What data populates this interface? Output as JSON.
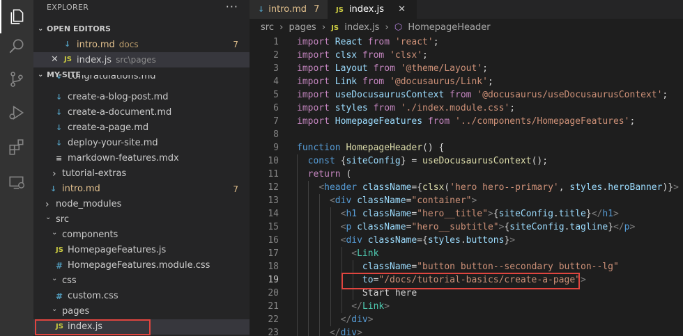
{
  "activity_bar": [
    {
      "name": "files-icon",
      "active": true
    },
    {
      "name": "search-icon"
    },
    {
      "name": "source-control-icon"
    },
    {
      "name": "run-debug-icon"
    },
    {
      "name": "extensions-icon"
    },
    {
      "name": "remote-explorer-icon"
    }
  ],
  "sidebar": {
    "title": "EXPLORER",
    "more": "···",
    "open_editors": {
      "header": "OPEN EDITORS",
      "items": [
        {
          "icon": "↓",
          "name": "intro.md",
          "dir": "docs",
          "badge": "7"
        },
        {
          "close": "✕",
          "icon": "JS",
          "name": "index.js",
          "dir": "src\\pages"
        }
      ]
    },
    "project": {
      "header": "MY-SITE",
      "tree": [
        {
          "icon": "↓",
          "name": "congratulations.md"
        },
        {
          "icon": "↓",
          "name": "create-a-blog-post.md"
        },
        {
          "icon": "↓",
          "name": "create-a-document.md"
        },
        {
          "icon": "↓",
          "name": "create-a-page.md"
        },
        {
          "icon": "↓",
          "name": "deploy-your-site.md"
        },
        {
          "icon": "≡",
          "name": "markdown-features.mdx"
        },
        {
          "chevron": "›",
          "name": "tutorial-extras"
        },
        {
          "icon": "↓",
          "name": "intro.md",
          "badge": "7"
        },
        {
          "chevron": "›",
          "name": "node_modules"
        },
        {
          "chevron": "⌄",
          "name": "src"
        },
        {
          "chevron": "⌄",
          "name": "components"
        },
        {
          "icon": "JS",
          "name": "HomepageFeatures.js"
        },
        {
          "icon": "#",
          "name": "HomepageFeatures.module.css"
        },
        {
          "chevron": "⌄",
          "name": "css"
        },
        {
          "icon": "#",
          "name": "custom.css"
        },
        {
          "chevron": "⌄",
          "name": "pages"
        },
        {
          "icon": "JS",
          "name": "index.js"
        }
      ]
    }
  },
  "editor": {
    "tabs": [
      {
        "icon": "↓",
        "name": "intro.md",
        "badge": "7"
      },
      {
        "icon": "JS",
        "name": "index.js",
        "close": "✕"
      }
    ],
    "breadcrumb": [
      "src",
      "›",
      "pages",
      "›",
      "JS",
      "index.js",
      "›",
      "⬡",
      "HomepageHeader"
    ],
    "line_numbers": [
      "1",
      "2",
      "3",
      "4",
      "5",
      "6",
      "7",
      "8",
      "9",
      "10",
      "11",
      "12",
      "13",
      "14",
      "15",
      "16",
      "17",
      "18",
      "19",
      "20",
      "21",
      "22",
      "23"
    ],
    "current_line": "19",
    "lines": [
      [
        [
          "kw2",
          "import "
        ],
        [
          "var",
          "React "
        ],
        [
          "kw2",
          "from "
        ],
        [
          "str",
          "'react'"
        ],
        [
          "punc",
          ";"
        ]
      ],
      [
        [
          "kw2",
          "import "
        ],
        [
          "var",
          "clsx "
        ],
        [
          "kw2",
          "from "
        ],
        [
          "str",
          "'clsx'"
        ],
        [
          "punc",
          ";"
        ]
      ],
      [
        [
          "kw2",
          "import "
        ],
        [
          "var",
          "Layout "
        ],
        [
          "kw2",
          "from "
        ],
        [
          "str",
          "'@theme/Layout'"
        ],
        [
          "punc",
          ";"
        ]
      ],
      [
        [
          "kw2",
          "import "
        ],
        [
          "var",
          "Link "
        ],
        [
          "kw2",
          "from "
        ],
        [
          "str",
          "'@docusaurus/Link'"
        ],
        [
          "punc",
          ";"
        ]
      ],
      [
        [
          "kw2",
          "import "
        ],
        [
          "var",
          "useDocusaurusContext "
        ],
        [
          "kw2",
          "from "
        ],
        [
          "str",
          "'@docusaurus/useDocusaurusContext'"
        ],
        [
          "punc",
          ";"
        ]
      ],
      [
        [
          "kw2",
          "import "
        ],
        [
          "var",
          "styles "
        ],
        [
          "kw2",
          "from "
        ],
        [
          "str",
          "'./index.module.css'"
        ],
        [
          "punc",
          ";"
        ]
      ],
      [
        [
          "kw2",
          "import "
        ],
        [
          "var",
          "HomepageFeatures "
        ],
        [
          "kw2",
          "from "
        ],
        [
          "str",
          "'../components/HomepageFeatures'"
        ],
        [
          "punc",
          ";"
        ]
      ],
      [],
      [
        [
          "kw",
          "function "
        ],
        [
          "fn",
          "HomepageHeader"
        ],
        [
          "punc",
          "() {"
        ]
      ],
      [
        [
          "plain",
          "  "
        ],
        [
          "kw",
          "const "
        ],
        [
          "punc",
          "{"
        ],
        [
          "var",
          "siteConfig"
        ],
        [
          "punc",
          "} = "
        ],
        [
          "fn",
          "useDocusaurusContext"
        ],
        [
          "punc",
          "();"
        ]
      ],
      [
        [
          "plain",
          "  "
        ],
        [
          "kw2",
          "return "
        ],
        [
          "punc",
          "("
        ]
      ],
      [
        [
          "plain",
          "    "
        ],
        [
          "brk",
          "<"
        ],
        [
          "tag",
          "header "
        ],
        [
          "attr",
          "className"
        ],
        [
          "punc",
          "={"
        ],
        [
          "fn",
          "clsx"
        ],
        [
          "punc",
          "("
        ],
        [
          "str",
          "'hero hero--primary'"
        ],
        [
          "punc",
          ", "
        ],
        [
          "var",
          "styles"
        ],
        [
          "punc",
          "."
        ],
        [
          "var",
          "heroBanner"
        ],
        [
          "punc",
          ")}"
        ],
        [
          "brk",
          ">"
        ]
      ],
      [
        [
          "plain",
          "      "
        ],
        [
          "brk",
          "<"
        ],
        [
          "tag",
          "div "
        ],
        [
          "attr",
          "className"
        ],
        [
          "punc",
          "="
        ],
        [
          "str",
          "\"container\""
        ],
        [
          "brk",
          ">"
        ]
      ],
      [
        [
          "plain",
          "        "
        ],
        [
          "brk",
          "<"
        ],
        [
          "tag",
          "h1 "
        ],
        [
          "attr",
          "className"
        ],
        [
          "punc",
          "="
        ],
        [
          "str",
          "\"hero__title\""
        ],
        [
          "brk",
          ">"
        ],
        [
          "punc",
          "{"
        ],
        [
          "var",
          "siteConfig"
        ],
        [
          "punc",
          "."
        ],
        [
          "var",
          "title"
        ],
        [
          "punc",
          "}"
        ],
        [
          "brk",
          "</"
        ],
        [
          "tag",
          "h1"
        ],
        [
          "brk",
          ">"
        ]
      ],
      [
        [
          "plain",
          "        "
        ],
        [
          "brk",
          "<"
        ],
        [
          "tag",
          "p "
        ],
        [
          "attr",
          "className"
        ],
        [
          "punc",
          "="
        ],
        [
          "str",
          "\"hero__subtitle\""
        ],
        [
          "brk",
          ">"
        ],
        [
          "punc",
          "{"
        ],
        [
          "var",
          "siteConfig"
        ],
        [
          "punc",
          "."
        ],
        [
          "var",
          "tagline"
        ],
        [
          "punc",
          "}"
        ],
        [
          "brk",
          "</"
        ],
        [
          "tag",
          "p"
        ],
        [
          "brk",
          ">"
        ]
      ],
      [
        [
          "plain",
          "        "
        ],
        [
          "brk",
          "<"
        ],
        [
          "tag",
          "div "
        ],
        [
          "attr",
          "className"
        ],
        [
          "punc",
          "={"
        ],
        [
          "var",
          "styles"
        ],
        [
          "punc",
          "."
        ],
        [
          "var",
          "buttons"
        ],
        [
          "punc",
          "}"
        ],
        [
          "brk",
          ">"
        ]
      ],
      [
        [
          "plain",
          "          "
        ],
        [
          "brk",
          "<"
        ],
        [
          "ttag",
          "Link"
        ]
      ],
      [
        [
          "plain",
          "            "
        ],
        [
          "attr",
          "className"
        ],
        [
          "punc",
          "="
        ],
        [
          "str",
          "\"button button--secondary button--lg\""
        ]
      ],
      [
        [
          "plain",
          "            "
        ],
        [
          "attr",
          "to"
        ],
        [
          "punc",
          "="
        ],
        [
          "str",
          "\"/docs/tutorial-basics/create-a-page\""
        ],
        [
          "brk",
          ">"
        ]
      ],
      [
        [
          "plain",
          "            "
        ],
        [
          "plain",
          "Start here"
        ]
      ],
      [
        [
          "plain",
          "          "
        ],
        [
          "brk",
          "</"
        ],
        [
          "ttag",
          "Link"
        ],
        [
          "brk",
          ">"
        ]
      ],
      [
        [
          "plain",
          "        "
        ],
        [
          "brk",
          "</"
        ],
        [
          "tag",
          "div"
        ],
        [
          "brk",
          ">"
        ]
      ],
      [
        [
          "plain",
          "      "
        ],
        [
          "brk",
          "</"
        ],
        [
          "tag",
          "div"
        ],
        [
          "brk",
          ">"
        ]
      ]
    ]
  },
  "colors": {
    "highlight_box": "#e0453f",
    "modified": "#e2c08d",
    "js_icon": "#cbcb41",
    "md_icon": "#519aba"
  }
}
